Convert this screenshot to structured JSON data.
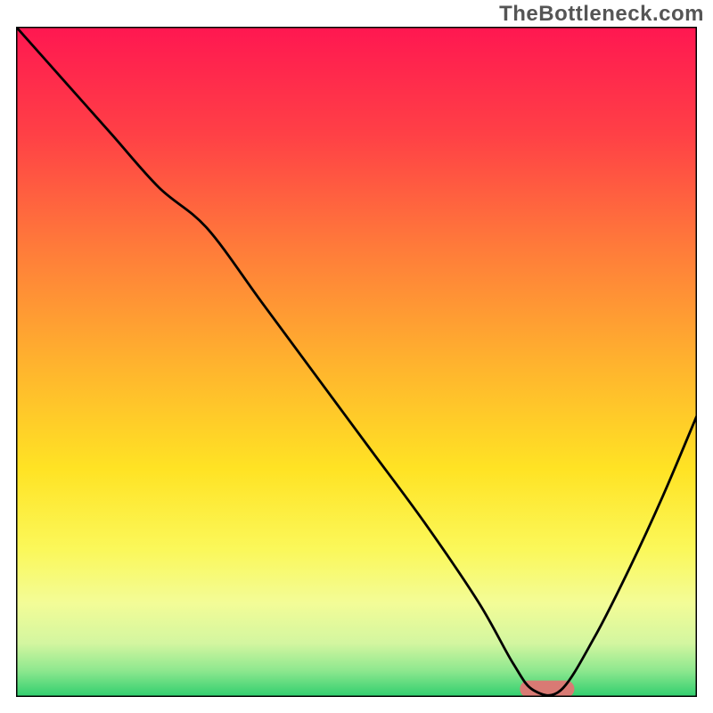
{
  "watermark": "TheBottleneck.com",
  "chart_data": {
    "type": "line",
    "title": "",
    "xlabel": "",
    "ylabel": "",
    "xlim": [
      0,
      100
    ],
    "ylim": [
      0,
      100
    ],
    "grid": false,
    "legend": false,
    "notes": "Background is a vertical smooth heat gradient (red→orange→yellow→green). A single black curve starts at upper-left, descends, flattens briefly near x≈76 at the bottom, then rises toward upper-right. A short salmon horizontal bar sits at the minimum.",
    "background_gradient_stops": [
      {
        "offset": 0.0,
        "color": "#ff1751"
      },
      {
        "offset": 0.16,
        "color": "#ff4046"
      },
      {
        "offset": 0.33,
        "color": "#ff7b3a"
      },
      {
        "offset": 0.5,
        "color": "#ffb22e"
      },
      {
        "offset": 0.66,
        "color": "#ffe324"
      },
      {
        "offset": 0.78,
        "color": "#fbf85a"
      },
      {
        "offset": 0.86,
        "color": "#f3fc97"
      },
      {
        "offset": 0.92,
        "color": "#d3f6a0"
      },
      {
        "offset": 0.96,
        "color": "#8fe88f"
      },
      {
        "offset": 1.0,
        "color": "#2fce6e"
      }
    ],
    "series": [
      {
        "name": "bottleneck-curve",
        "color": "#000000",
        "x": [
          0,
          7,
          14,
          21,
          28,
          36,
          44,
          52,
          60,
          68,
          73,
          76,
          80,
          85,
          90,
          95,
          100
        ],
        "y": [
          100,
          92,
          84,
          76,
          70,
          59,
          48,
          37,
          26,
          14,
          5,
          1,
          1,
          9,
          19,
          30,
          42
        ]
      }
    ],
    "marker": {
      "name": "min-marker",
      "color": "#d97a74",
      "x_start": 74,
      "x_end": 82,
      "y": 1.2,
      "height": 2.5
    }
  }
}
